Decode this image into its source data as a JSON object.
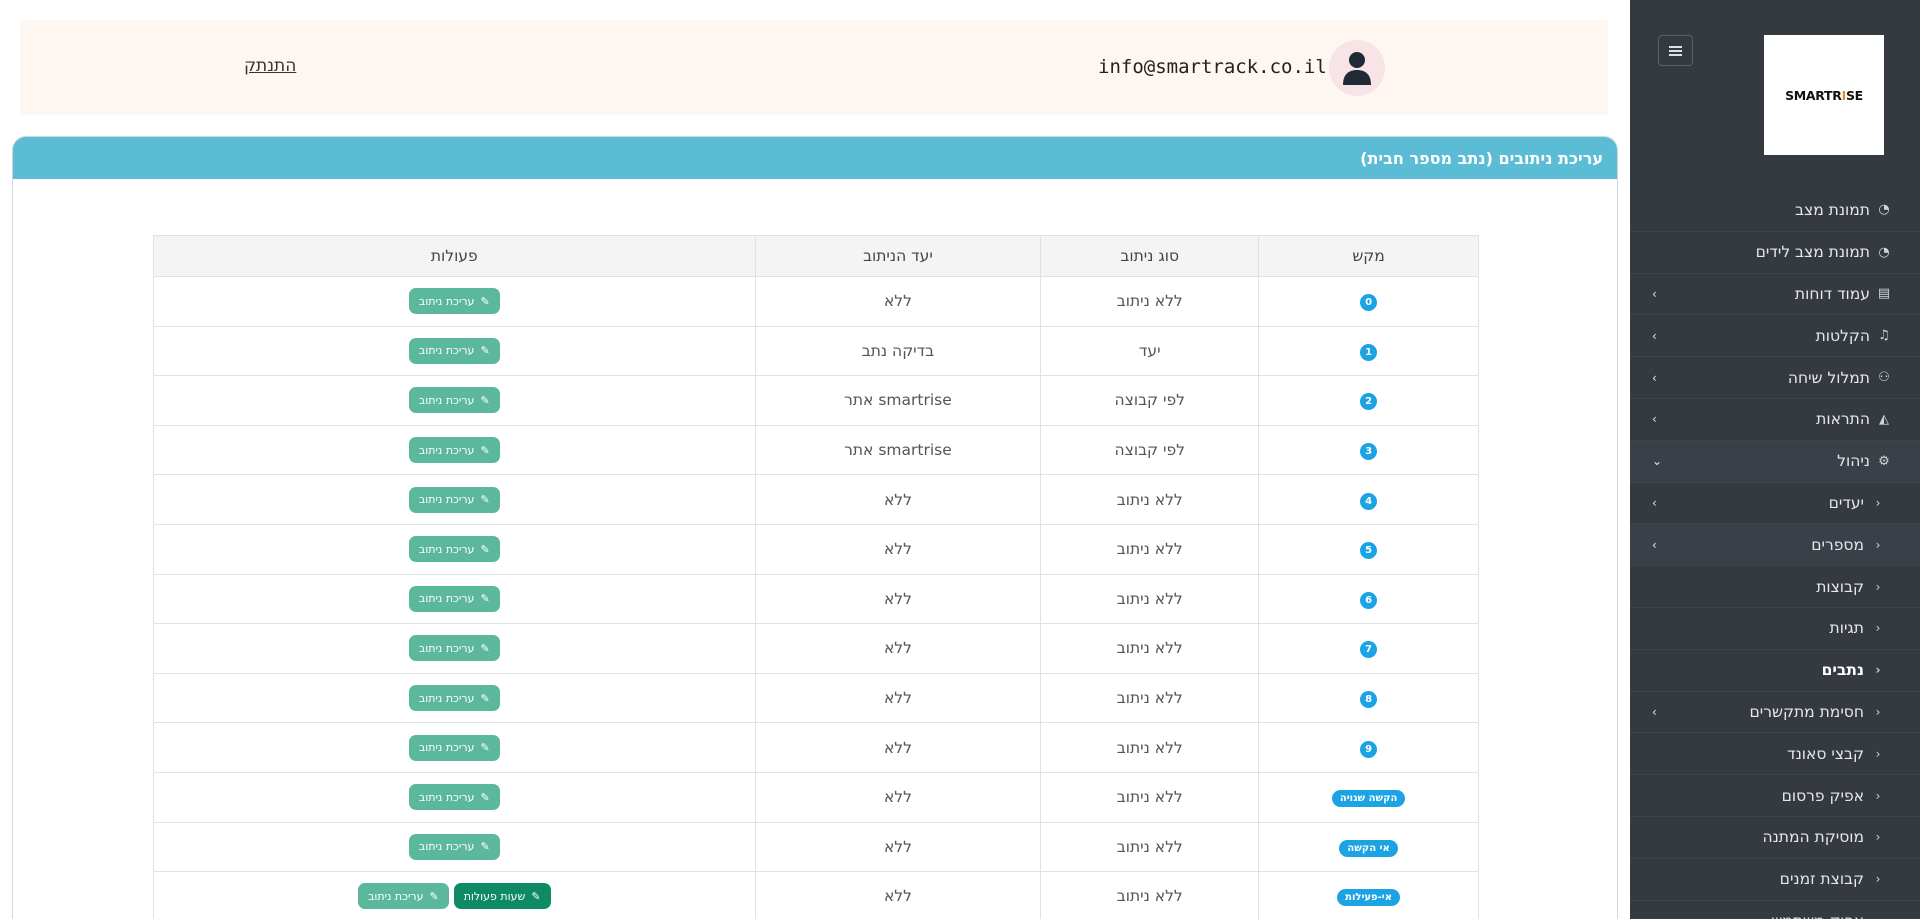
{
  "sidebar": {
    "logo": {
      "main": "SMARTR",
      "accent": "I",
      "rest": "SE"
    },
    "items": [
      {
        "label": "תמונת מצב",
        "icon": "gauge-icon",
        "glyph": "◔",
        "arrow": ""
      },
      {
        "label": "תמונת מצב לידים",
        "icon": "gauge-icon",
        "glyph": "◔",
        "arrow": ""
      },
      {
        "label": "עמוד דוחות",
        "icon": "report-icon",
        "glyph": "▤",
        "arrow": "›"
      },
      {
        "label": "הקלטות",
        "icon": "music-icon",
        "glyph": "♫",
        "arrow": "›"
      },
      {
        "label": "תמלול שיחה",
        "icon": "transcript-icon",
        "glyph": "⚇",
        "arrow": "›"
      },
      {
        "label": "התראות",
        "icon": "bell-icon",
        "glyph": "◭",
        "arrow": "›"
      },
      {
        "label": "ניהול",
        "icon": "gear-icon",
        "glyph": "⚙",
        "arrow": "⌄"
      }
    ],
    "sub_items": [
      {
        "label": "יעדים",
        "arrow": "›"
      },
      {
        "label": "מספרים",
        "arrow": "›"
      },
      {
        "label": "קבוצות",
        "arrow": ""
      },
      {
        "label": "תגיות",
        "arrow": ""
      },
      {
        "label": "נתבים",
        "arrow": ""
      },
      {
        "label": "חסימת מתקשרים",
        "arrow": "›"
      },
      {
        "label": "קבצי סאונד",
        "arrow": ""
      },
      {
        "label": "אפיק פרסום",
        "arrow": ""
      },
      {
        "label": "מוסיקת המתנה",
        "arrow": ""
      },
      {
        "label": "קבוצת זמנים",
        "arrow": ""
      },
      {
        "label": "אפיק משתמש",
        "arrow": ""
      }
    ]
  },
  "header": {
    "logout": "התנתק",
    "email": "info@smartrack.co.il"
  },
  "card": {
    "title": "עריכת ניתובים (נתב מספר חבית)"
  },
  "table": {
    "columns": [
      "מקש",
      "סוג ניתוב",
      "יעד הניתוב",
      "פעולות"
    ],
    "edit_label": "עריכת ניתוב",
    "extra_label": "שעות פעולות",
    "rows": [
      {
        "key": "0",
        "type": "ללא ניתוב",
        "dest": "ללא"
      },
      {
        "key": "1",
        "type": "יעד",
        "dest": "בדיקה נתב"
      },
      {
        "key": "2",
        "type": "לפי קבוצה",
        "dest": "smartrise אתר"
      },
      {
        "key": "3",
        "type": "לפי קבוצה",
        "dest": "smartrise אתר"
      },
      {
        "key": "4",
        "type": "ללא ניתוב",
        "dest": "ללא"
      },
      {
        "key": "5",
        "type": "ללא ניתוב",
        "dest": "ללא"
      },
      {
        "key": "6",
        "type": "ללא ניתוב",
        "dest": "ללא"
      },
      {
        "key": "7",
        "type": "ללא ניתוב",
        "dest": "ללא"
      },
      {
        "key": "8",
        "type": "ללא ניתוב",
        "dest": "ללא"
      },
      {
        "key": "9",
        "type": "ללא ניתוב",
        "dest": "ללא"
      },
      {
        "key": "הקשה שגויה",
        "type": "ללא ניתוב",
        "dest": "ללא"
      },
      {
        "key": "אי הקשה",
        "type": "ללא ניתוב",
        "dest": "ללא"
      },
      {
        "key": "אי-פעילות",
        "type": "ללא ניתוב",
        "dest": "ללא",
        "extra": true
      }
    ]
  },
  "colors": {
    "sidebar_bg": "#343a40",
    "header_accent": "#5bbcd6",
    "badge": "#1ca3e3",
    "button": "#5cb89c",
    "button_dark": "#0e8a65"
  }
}
